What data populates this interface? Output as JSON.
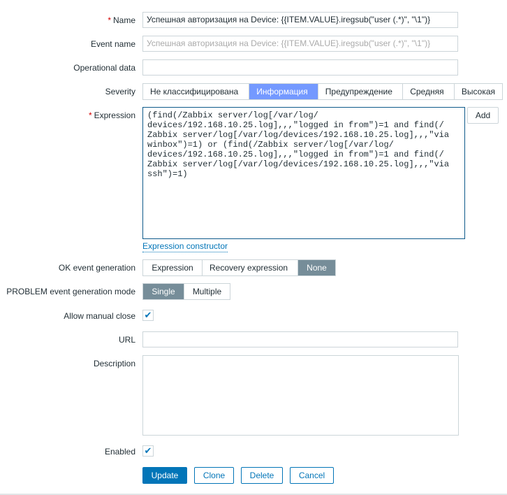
{
  "form": {
    "name": {
      "label": "Name",
      "value": "Успешная авторизация на Device: {{ITEM.VALUE}.iregsub(\"user (.*)\", \"\\1\")}"
    },
    "event_name": {
      "label": "Event name",
      "placeholder": "Успешная авторизация на Device: {{ITEM.VALUE}.iregsub(\"user (.*)\", \"\\1\")}"
    },
    "operational_data": {
      "label": "Operational data",
      "value": ""
    },
    "severity": {
      "label": "Severity",
      "options": [
        "Не классифицирована",
        "Информация",
        "Предупреждение",
        "Средняя",
        "Высокая"
      ],
      "selected": "Информация"
    },
    "expression": {
      "label": "Expression",
      "value": "(find(/Zabbix server/log[/var/log/\ndevices/192.168.10.25.log],,,\"logged in from\")=1 and find(/\nZabbix server/log[/var/log/devices/192.168.10.25.log],,,\"via\nwinbox\")=1) or (find(/Zabbix server/log[/var/log/\ndevices/192.168.10.25.log],,,\"logged in from\")=1 and find(/\nZabbix server/log[/var/log/devices/192.168.10.25.log],,,\"via\nssh\")=1)",
      "add_label": "Add",
      "constructor_link": "Expression constructor"
    },
    "ok_event": {
      "label": "OK event generation",
      "options": [
        "Expression",
        "Recovery expression",
        "None"
      ],
      "selected": "None"
    },
    "problem_mode": {
      "label": "PROBLEM event generation mode",
      "options": [
        "Single",
        "Multiple"
      ],
      "selected": "Single"
    },
    "allow_manual_close": {
      "label": "Allow manual close",
      "checked": true
    },
    "url": {
      "label": "URL",
      "value": ""
    },
    "description": {
      "label": "Description",
      "value": ""
    },
    "enabled": {
      "label": "Enabled",
      "checked": true
    },
    "buttons": {
      "update": "Update",
      "clone": "Clone",
      "delete": "Delete",
      "cancel": "Cancel"
    }
  },
  "colors": {
    "primary": "#0275b8",
    "selected_severity": "#7499ff",
    "selected_toggle": "#768d99",
    "required": "#d40000"
  }
}
